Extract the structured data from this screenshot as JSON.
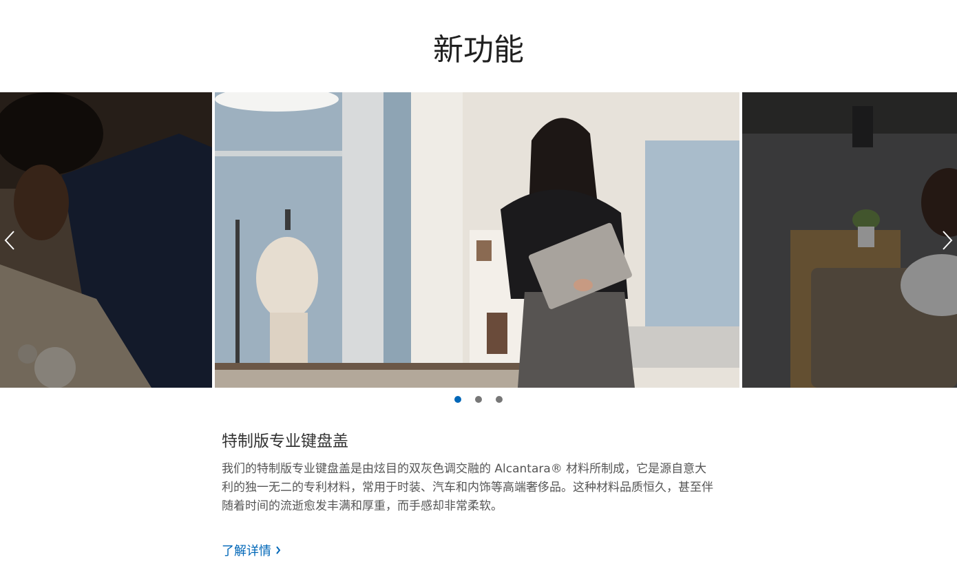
{
  "section": {
    "heading": "新功能"
  },
  "carousel": {
    "slides": [
      "artist-drawing",
      "woman-with-surface-laptop",
      "office-lounge"
    ],
    "active_index": 1,
    "dot_count": 3,
    "prev_icon": "chevron-left-icon",
    "next_icon": "chevron-right-icon"
  },
  "feature": {
    "title": "特制版专业键盘盖",
    "description": "我们的特制版专业键盘盖是由炫目的双灰色调交融的 Alcantara® 材料所制成，它是源自意大利的独一无二的专利材料，常用于时装、汽车和内饰等高端奢侈品。这种材料品质恒久，甚至伴随着时间的流逝愈发丰满和厚重，而手感却非常柔软。",
    "link_label": "了解详情",
    "link_icon": "chevron-right-icon"
  },
  "colors": {
    "accent": "#0067b8",
    "dot_inactive": "#777777",
    "heading": "#1f1f1f",
    "body_text": "#555555"
  }
}
